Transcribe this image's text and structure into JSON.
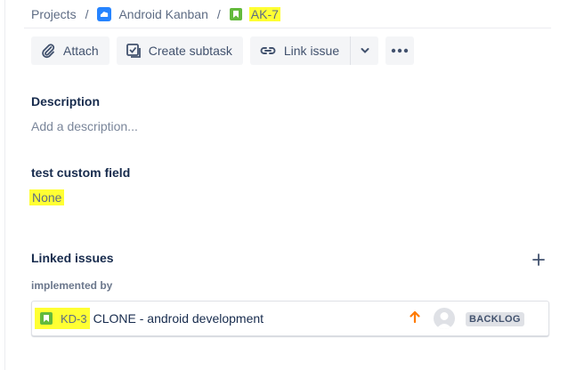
{
  "breadcrumb": {
    "projects": "Projects",
    "project": "Android Kanban",
    "issue": "AK-7",
    "separator": "/"
  },
  "toolbar": {
    "attach": "Attach",
    "create_subtask": "Create subtask",
    "link_issue": "Link issue"
  },
  "description": {
    "label": "Description",
    "placeholder": "Add a description..."
  },
  "custom_field": {
    "label": "test custom field",
    "value": "None"
  },
  "linked_issues": {
    "label": "Linked issues",
    "relation": "implemented by",
    "items": [
      {
        "key": "KD-3",
        "summary": "CLONE - android development",
        "status": "BACKLOG",
        "priority": "high"
      }
    ]
  },
  "colors": {
    "highlight": "#ffff33",
    "story_icon": "#63ba3c",
    "project_icon": "#2684ff",
    "priority": "#ff7b00"
  }
}
